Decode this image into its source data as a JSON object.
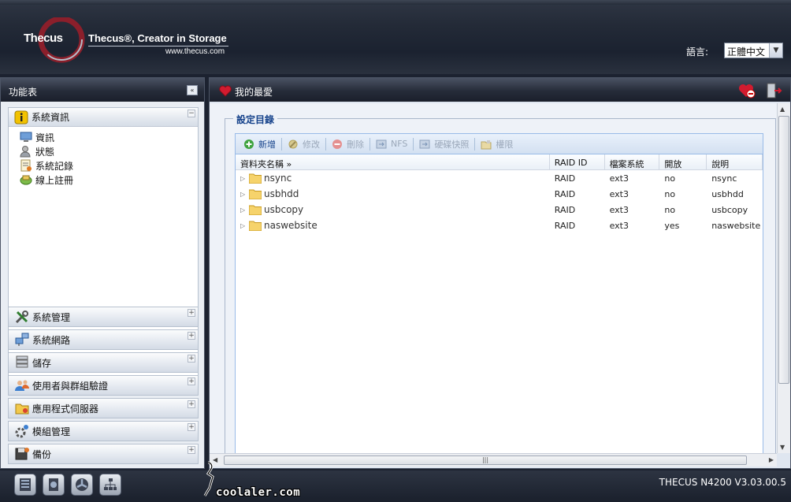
{
  "header": {
    "logo_word": "Thecus",
    "slogan": "Thecus®, Creator in Storage",
    "website": "www.thecus.com",
    "language_label": "語言:",
    "language_value": "正體中文"
  },
  "left_panel": {
    "title": "功能表",
    "collapse_symbol": "«",
    "open_section": {
      "label": "系統資訊",
      "toggle": "−",
      "items": [
        {
          "label": "資訊",
          "icon": "monitor-icon"
        },
        {
          "label": "狀態",
          "icon": "user-status-icon"
        },
        {
          "label": "系統記錄",
          "icon": "log-icon"
        },
        {
          "label": "線上註冊",
          "icon": "register-icon"
        }
      ]
    },
    "sections": [
      {
        "label": "系統管理",
        "icon": "tools-icon",
        "toggle": "+"
      },
      {
        "label": "系統網路",
        "icon": "network-icon",
        "toggle": "+"
      },
      {
        "label": "儲存",
        "icon": "storage-icon",
        "toggle": "+"
      },
      {
        "label": "使用者與群組驗證",
        "icon": "users-icon",
        "toggle": "+"
      },
      {
        "label": "應用程式伺服器",
        "icon": "app-server-icon",
        "toggle": "+"
      },
      {
        "label": "模組管理",
        "icon": "module-icon",
        "toggle": "+"
      },
      {
        "label": "備份",
        "icon": "backup-icon",
        "toggle": "+"
      }
    ]
  },
  "right_panel": {
    "title": "我的最愛",
    "fieldset_legend": "設定目錄",
    "toolbar": [
      {
        "label": "新增",
        "enabled": true,
        "icon": "add-icon"
      },
      {
        "label": "修改",
        "enabled": false,
        "icon": "edit-icon"
      },
      {
        "label": "刪除",
        "enabled": false,
        "icon": "delete-icon"
      },
      {
        "label": "NFS",
        "enabled": false,
        "icon": "nfs-icon"
      },
      {
        "label": "硬碟快照",
        "enabled": false,
        "icon": "snapshot-icon"
      },
      {
        "label": "權限",
        "enabled": false,
        "icon": "permission-icon"
      }
    ],
    "columns": [
      "資料夾名稱 »",
      "RAID ID",
      "檔案系統",
      "開放",
      "說明"
    ],
    "rows": [
      [
        "nsync",
        "RAID",
        "ext3",
        "no",
        "nsync"
      ],
      [
        "usbhdd",
        "RAID",
        "ext3",
        "no",
        "usbhdd"
      ],
      [
        "usbcopy",
        "RAID",
        "ext3",
        "no",
        "usbcopy"
      ],
      [
        "naswebsite",
        "RAID",
        "ext3",
        "yes",
        "naswebsite"
      ]
    ]
  },
  "footer": {
    "version": "THECUS N4200 V3.03.00.5",
    "watermark": "coolaler.com"
  },
  "colors": {
    "accent_blue": "#15428b",
    "header_dark": "#1b2230",
    "favorite_red": "#c8102e"
  }
}
